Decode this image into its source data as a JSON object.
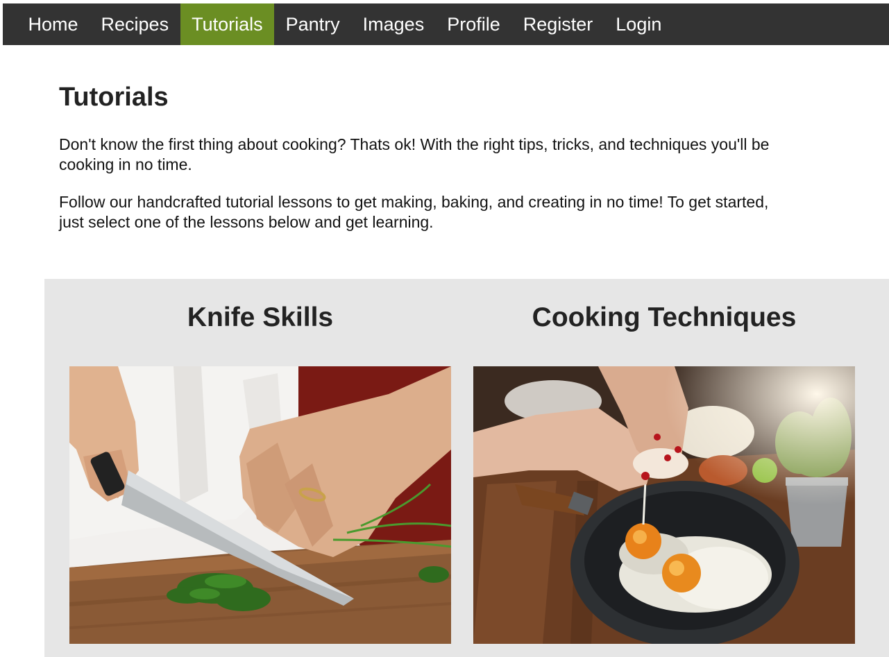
{
  "nav": {
    "items": [
      {
        "label": "Home"
      },
      {
        "label": "Recipes"
      },
      {
        "label": "Tutorials",
        "active": true
      },
      {
        "label": "Pantry"
      },
      {
        "label": "Images"
      },
      {
        "label": "Profile"
      },
      {
        "label": "Register"
      },
      {
        "label": "Login"
      }
    ]
  },
  "intro": {
    "title": "Tutorials",
    "paragraph1": "Don't know the first thing about cooking? Thats ok! With the right tips, tricks, and techniques you'll be cooking in no time.",
    "paragraph2": "Follow our handcrafted tutorial lessons to get making, baking, and creating in no time! To get started, just select one of the lessons below and get learning."
  },
  "lessons": [
    {
      "title": "Knife Skills",
      "image": "knife-chopping-herbs-photo"
    },
    {
      "title": "Cooking Techniques",
      "image": "eggs-frying-in-pan-photo"
    }
  ],
  "colors": {
    "nav_bg": "#333333",
    "nav_active": "#6b8e23",
    "lessons_bg": "#e6e6e6"
  }
}
